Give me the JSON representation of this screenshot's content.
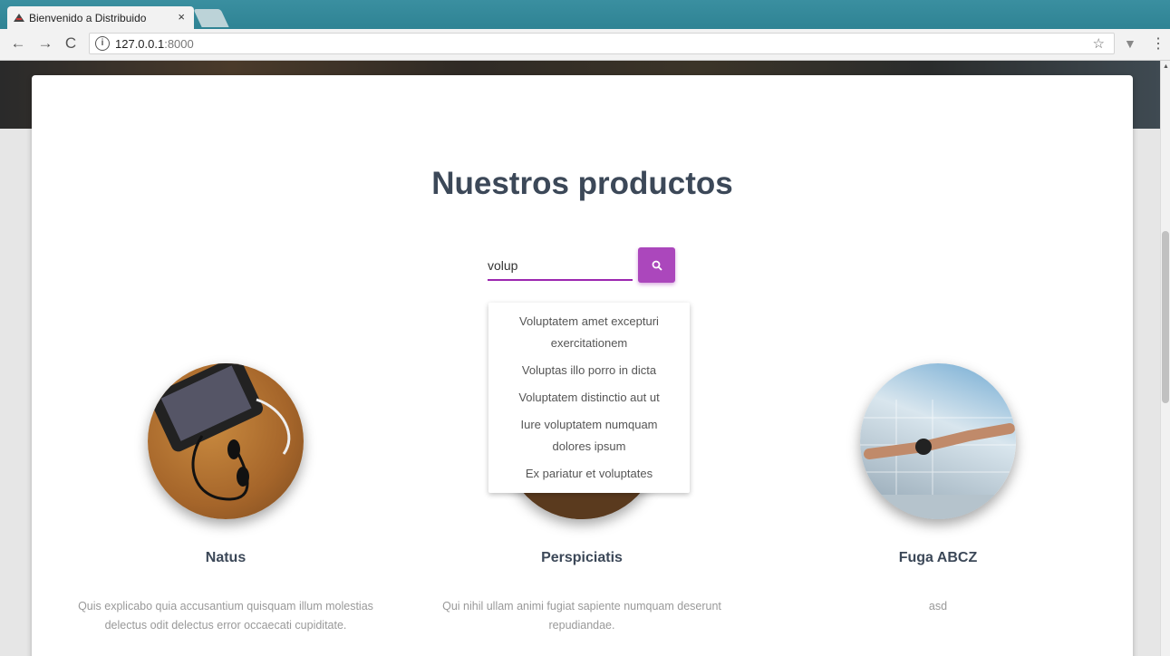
{
  "browser": {
    "tab_title": "Bienvenido a Distribuido",
    "tab_close": "×",
    "url_host": "127.0.0.1",
    "url_port": ":8000",
    "back": "←",
    "forward": "→",
    "reload": "C",
    "star": "☆",
    "extension": "▼",
    "menu": "⋮",
    "info": "i"
  },
  "page": {
    "heading": "Nuestros productos",
    "search": {
      "value": "volup",
      "placeholder": ""
    },
    "suggestions": [
      "Voluptatem amet excepturi exercitationem",
      "Voluptas illo porro in dicta",
      "Voluptatem distinctio aut ut",
      "Iure voluptatem numquam dolores ipsum",
      "Ex pariatur et voluptates"
    ],
    "products": [
      {
        "name": "Natus",
        "description": "Quis explicabo quia accusantium quisquam illum molestias delectus odit delectus error occaecati cupiditate."
      },
      {
        "name": "Perspiciatis",
        "description": "Qui nihil ullam animi fugiat sapiente numquam deserunt repudiandae."
      },
      {
        "name": "Fuga ABCZ",
        "description": "asd"
      }
    ]
  },
  "colors": {
    "accent": "#ab47bc",
    "heading": "#3c4858"
  }
}
